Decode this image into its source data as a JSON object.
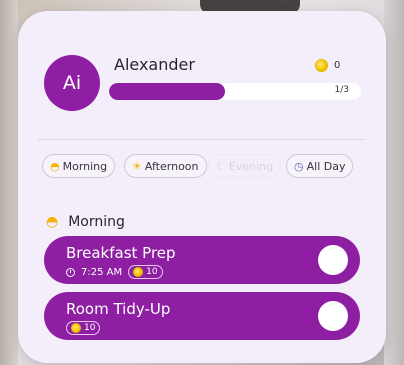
{
  "user": {
    "avatar_text": "Ai",
    "name": "Alexander",
    "coins": "0",
    "progress_text": "1/3",
    "progress_fraction": 0.46
  },
  "filters": [
    {
      "label": "Morning",
      "icon": "half-sun-icon",
      "state": "active"
    },
    {
      "label": "Afternoon",
      "icon": "sun-icon",
      "state": "active"
    },
    {
      "label": "Evening",
      "icon": "moon-icon",
      "state": "disabled"
    },
    {
      "label": "All Day",
      "icon": "clock-icon",
      "state": "active"
    }
  ],
  "section": {
    "title": "Morning",
    "icon": "half-sun-icon"
  },
  "tasks": [
    {
      "title": "Breakfast Prep",
      "time": "7:25 AM",
      "points": "10"
    },
    {
      "title": "Room Tidy-Up",
      "points": "10"
    }
  ],
  "colors": {
    "accent": "#8e1fa3",
    "card_bg": "#f4eefa",
    "coin": "#f5c800"
  }
}
